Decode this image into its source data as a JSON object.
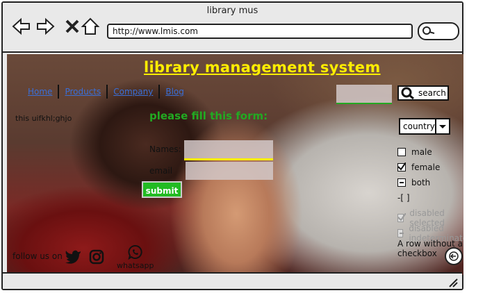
{
  "window": {
    "title": "library mus",
    "url": "http://www.lmis.com"
  },
  "page": {
    "heading": "library management system",
    "nav": [
      "Home",
      "Products",
      "Company",
      "Blog"
    ],
    "side_text": "this uifkhl;ghjo",
    "form": {
      "title": "please fill this form:",
      "names_label": "Names:",
      "email_label": "email",
      "submit_label": "submit"
    },
    "search": {
      "button_label": "search"
    },
    "select": {
      "value": "country"
    },
    "checkboxes": [
      {
        "label": "male",
        "state": "unchecked"
      },
      {
        "label": "female",
        "state": "checked"
      },
      {
        "label": "both",
        "state": "indeterminate"
      },
      {
        "label": "-[ ]",
        "state": "none"
      },
      {
        "label": "disabled selected",
        "state": "disabled-checked"
      },
      {
        "label": "disabled indeterminate",
        "state": "disabled-indeterminate"
      },
      {
        "label": "A row without a checkbox",
        "state": "none"
      }
    ],
    "footer": {
      "follow_label": "follow us on",
      "whatsapp_label": "whatsapp"
    }
  },
  "colors": {
    "heading": "#ffee00",
    "form_title": "#22aa22",
    "link": "#3a6fd8",
    "submit": "#22bb22"
  }
}
